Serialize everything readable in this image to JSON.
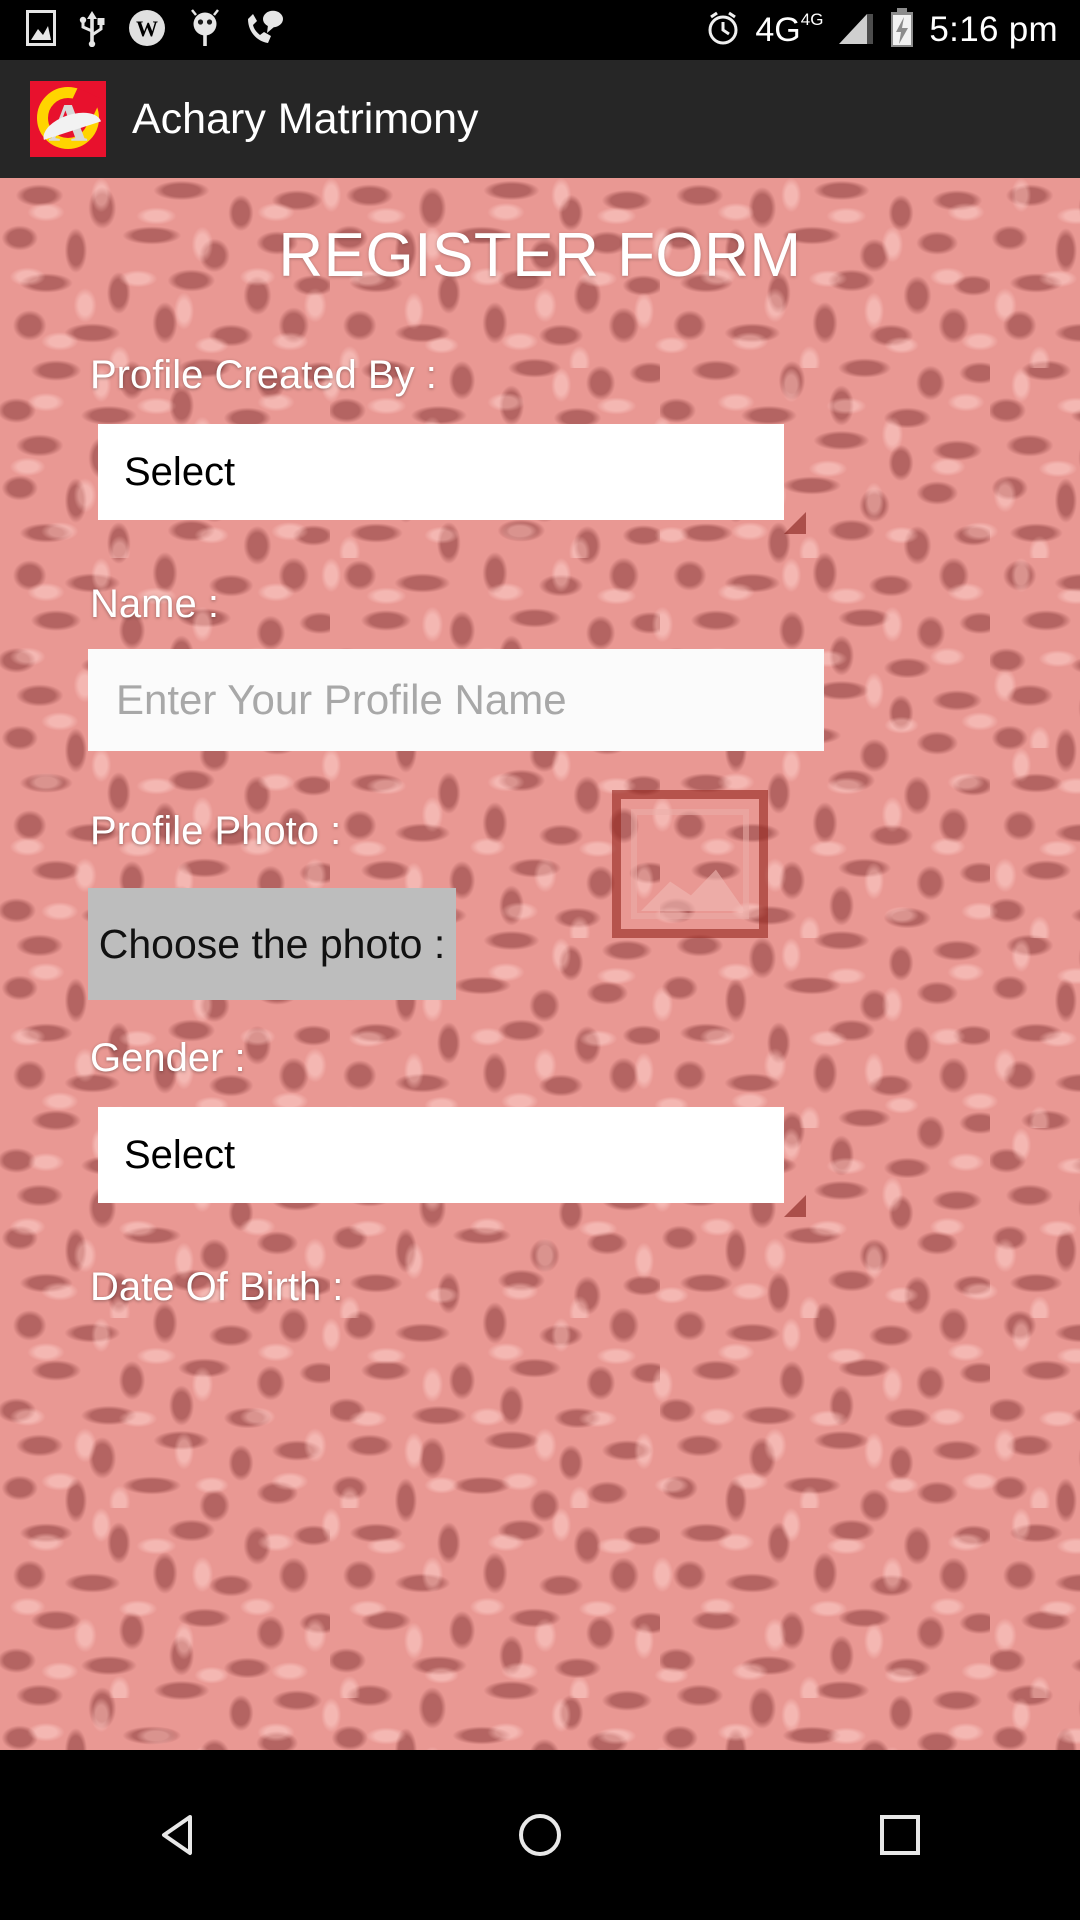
{
  "status_bar": {
    "time": "5:16 pm",
    "network_label": "4G",
    "network_superscript": "4G",
    "left_icons": [
      "image-icon",
      "usb-icon",
      "w-badge-icon",
      "android-robot-icon",
      "phone-message-icon"
    ],
    "right_icons": [
      "alarm-clock-icon",
      "signal-icon",
      "battery-charging-icon"
    ]
  },
  "app_bar": {
    "title": "Achary Matrimony",
    "logo_letter": "A",
    "logo_colors": {
      "background": "#e8112d",
      "ring": "#ffd400",
      "letter": "#d8d8d8"
    },
    "background": "#262626"
  },
  "page": {
    "title": "REGISTER FORM",
    "background_accent": "#cf3a32"
  },
  "fields": {
    "profile_created_by": {
      "label": "Profile Created By :",
      "value": "Select",
      "type": "spinner"
    },
    "name": {
      "label": "Name :",
      "value": "",
      "placeholder": "Enter Your Profile Name",
      "type": "text"
    },
    "profile_photo": {
      "label": "Profile Photo :",
      "button_label": "Choose the photo :",
      "preview_icon": "image-placeholder-icon",
      "type": "file"
    },
    "gender": {
      "label": "Gender :",
      "value": "Select",
      "type": "spinner"
    },
    "date_of_birth": {
      "label": "Date Of Birth :",
      "type": "date"
    }
  },
  "nav_bar": {
    "back_label": "back-icon",
    "home_label": "home-icon",
    "recents_label": "recents-icon"
  }
}
